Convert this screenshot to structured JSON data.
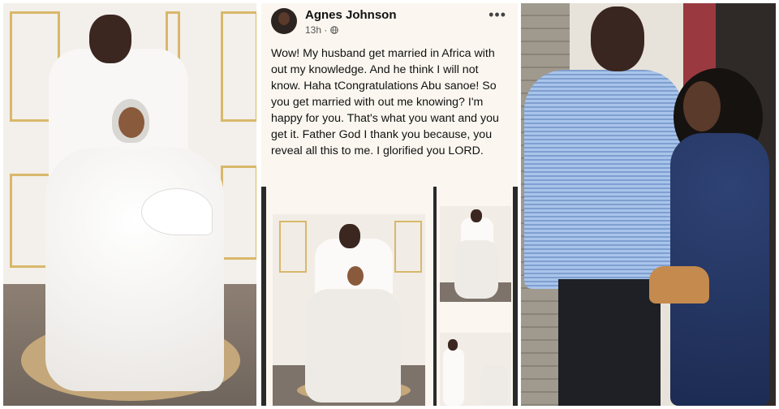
{
  "post": {
    "author": "Agnes Johnson",
    "time": "13h",
    "privacy_icon": "globe-icon",
    "more_icon": "more-options-icon",
    "text": "Wow! My husband get married in Africa with out my knowledge. And he think I will not know. Haha tCongratulations Abu sanoe! So you get married with out me knowing? I'm happy for you. That's what you want and you get it. Father God I thank you because, you reveal all this to me. I glorified you LORD."
  },
  "colors": {
    "frame_gold": "#d8b86a",
    "wedding_white": "#f7f5f2",
    "shirt_blue": "#8fb3e0",
    "dress_navy": "#1c2b52",
    "bag_tan": "#c58a4e"
  }
}
